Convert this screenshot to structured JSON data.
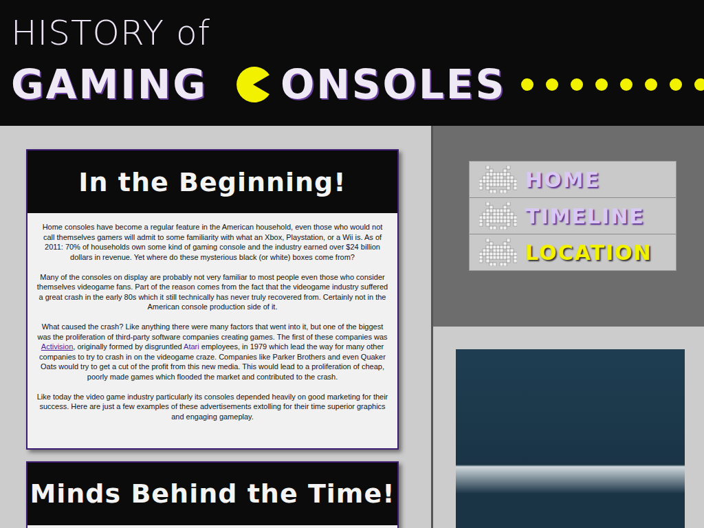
{
  "header": {
    "line1": "HISTORY of",
    "word1": "GAMING",
    "word2": "ONSOLES"
  },
  "nav": {
    "items": [
      {
        "label": "HOME",
        "selected": false
      },
      {
        "label": "TIMELINE",
        "selected": false
      },
      {
        "label": "LOCATION",
        "selected": true
      }
    ]
  },
  "articles": [
    {
      "title": "In the Beginning!",
      "paragraphs": [
        [
          {
            "kind": "plain",
            "text": "Home consoles have become a regular feature in the American household, even those who would not call themselves gamers will admit to some familiarity with what an Xbox, Playstation, or a Wii is. As of 2011: 70% of households own some kind of gaming console and the industry earned over $24 billion dollars in revenue. Yet where do these mysterious black (or white) boxes come from?",
            "underlined": false
          }
        ],
        [
          {
            "kind": "plain",
            "text": "Many of the consoles on display are probably not very familiar to most people even those who consider themselves videogame fans. Part of the reason comes from the fact that the videogame industry suffered a great crash in the early 80s which it still technically has never truly recovered from. Certainly not in the American console production side of it.",
            "underlined": false
          }
        ],
        [
          {
            "kind": "plain",
            "text": "What caused the crash? Like anything there were many factors that went into it, but one of the biggest was the proliferation of third-party software companies creating games. The first of these companies was ",
            "underlined": false
          },
          {
            "kind": "link",
            "text": "Activision",
            "underlined": true
          },
          {
            "kind": "plain",
            "text": ", originally formed by disgruntled ",
            "underlined": false
          },
          {
            "kind": "link",
            "text": "Atari",
            "underlined": false
          },
          {
            "kind": "plain",
            "text": " employees, in 1979 which lead the way for many other companies to try to crash in on the videogame craze. Companies like Parker Brothers and even Quaker Oats would try to get a cut of the profit from this new media. This would lead to a proliferation of cheap, poorly made games which flooded the market and contributed to the crash.",
            "underlined": false
          }
        ],
        [
          {
            "kind": "plain",
            "text": "Like today the video game industry particularly its consoles depended heavily on good marketing for their success. Here are just a few examples of these advertisements extolling for their time superior graphics and engaging gameplay.",
            "underlined": false
          }
        ]
      ]
    },
    {
      "title": "Minds Behind the Time!",
      "paragraphs": []
    }
  ]
}
